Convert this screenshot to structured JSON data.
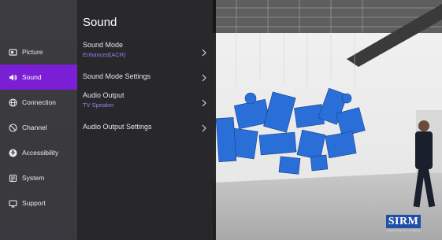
{
  "sidebar": {
    "items": [
      {
        "label": "Picture",
        "icon": "picture-icon",
        "active": false
      },
      {
        "label": "Sound",
        "icon": "speaker-icon",
        "active": true
      },
      {
        "label": "Connection",
        "icon": "globe-icon",
        "active": false
      },
      {
        "label": "Channel",
        "icon": "channel-icon",
        "active": false
      },
      {
        "label": "Accessibility",
        "icon": "accessibility-icon",
        "active": false
      },
      {
        "label": "System",
        "icon": "system-icon",
        "active": false
      },
      {
        "label": "Support",
        "icon": "support-icon",
        "active": false
      }
    ],
    "active_color": "#7a1fd6"
  },
  "panel": {
    "title": "Sound",
    "rows": [
      {
        "label": "Sound Mode",
        "value": "Enhanced(ACR)"
      },
      {
        "label": "Sound Mode Settings",
        "value": ""
      },
      {
        "label": "Audio Output",
        "value": "TV Speaker"
      },
      {
        "label": "Audio Output Settings",
        "value": ""
      }
    ],
    "value_color": "#9d7cf0"
  },
  "watermark": {
    "main": "SIRM",
    "sub": "SINGAPORE ART MUSEUM"
  }
}
